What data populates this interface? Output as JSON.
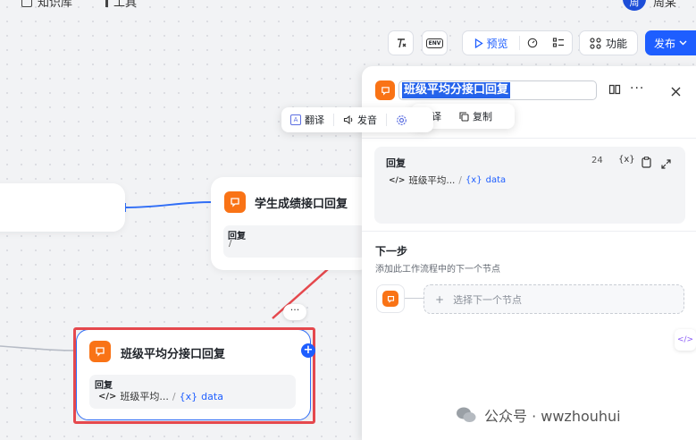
{
  "topbar": {
    "item1_label": "知识库",
    "item2_label": "工具",
    "avatar_text": "周",
    "user_name": "周某"
  },
  "toolbar": {
    "env_label": "ENV",
    "preview_label": "预览",
    "features_label": "功能",
    "publish_label": "发布"
  },
  "canvas": {
    "node_student": {
      "title": "学生成绩接口回复",
      "reply_label": "回复",
      "reply_value": "/"
    },
    "node_class": {
      "title": "班级平均分接口回复",
      "reply_label": "回复",
      "code_text": "班级平均...",
      "separator": "/",
      "var_text": "data"
    },
    "more_dots": "···",
    "plus": "+"
  },
  "translate_bar": {
    "translate_label": "翻译",
    "speak_label": "发音"
  },
  "copy_bar": {
    "translate_label": "翻译",
    "copy_label": "复制"
  },
  "panel": {
    "title_value": "班级平均分接口回复",
    "reply": {
      "label": "回复",
      "count": "24",
      "code_text": "班级平均...",
      "separator": "/",
      "var_text": "data"
    },
    "next_step": {
      "title": "下一步",
      "description": "添加此工作流程中的下一个节点",
      "select_placeholder": "选择下一个节点"
    }
  },
  "watermark": {
    "text": "公众号 · wwzhouhui"
  },
  "colors": {
    "accent": "#1e5eff",
    "node_icon": "#f97316",
    "highlight": "#e5484d",
    "title_selection": "#2563eb"
  }
}
